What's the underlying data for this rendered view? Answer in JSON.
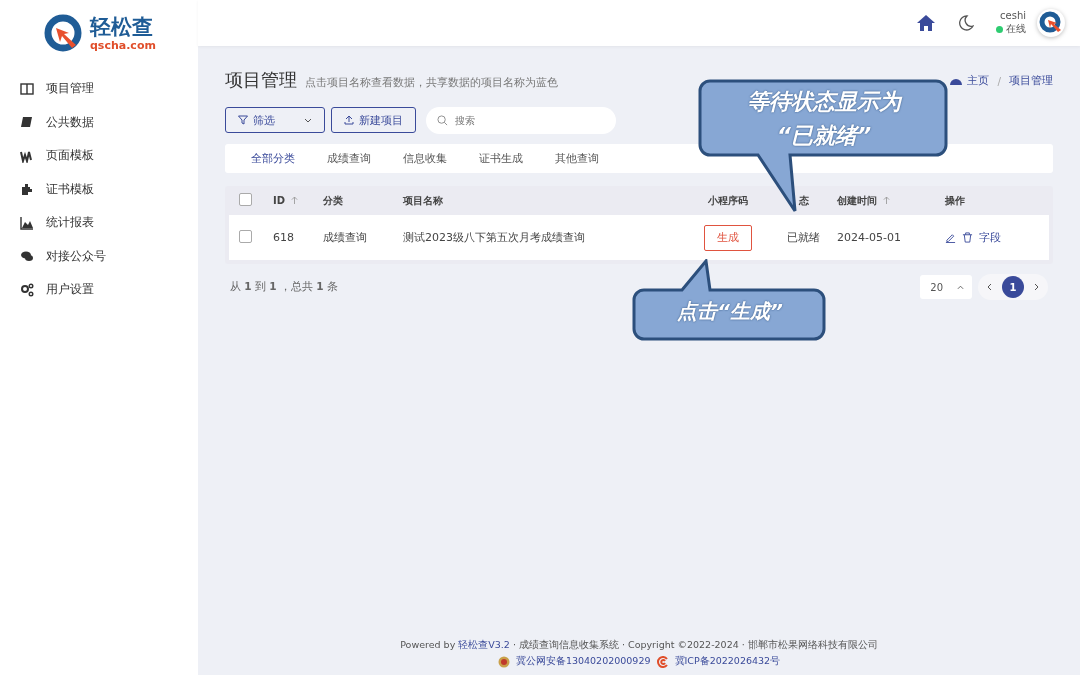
{
  "logo": {
    "name": "轻松查",
    "domain": "qscha.com"
  },
  "sidebar": {
    "items": [
      {
        "label": "项目管理"
      },
      {
        "label": "公共数据"
      },
      {
        "label": "页面模板"
      },
      {
        "label": "证书模板"
      },
      {
        "label": "统计报表"
      },
      {
        "label": "对接公众号"
      },
      {
        "label": "用户设置"
      }
    ]
  },
  "header": {
    "username": "ceshi",
    "status": "在线",
    "online": true
  },
  "page": {
    "title": "项目管理",
    "subtitle": "点击项目名称查看数据，共享数据的项目名称为蓝色",
    "breadcrumb": [
      "主页",
      "/",
      "项目管理"
    ]
  },
  "toolbar": {
    "filter": "筛选",
    "new_project": "新建项目",
    "search": {
      "placeholder": "搜索"
    }
  },
  "category_tabs": [
    {
      "label": "全部分类",
      "selected": true
    },
    {
      "label": "成绩查询",
      "selected": false
    },
    {
      "label": "信息收集",
      "selected": false
    },
    {
      "label": "证书生成",
      "selected": false
    },
    {
      "label": "其他查询",
      "selected": false
    }
  ],
  "table": {
    "all_checked": false,
    "columns": [
      {
        "label": "ID",
        "sortable": true
      },
      {
        "label": "分类",
        "sortable": false
      },
      {
        "label": "项目名称",
        "sortable": false
      },
      {
        "label": "小程序码",
        "sortable": false
      },
      {
        "label": "态",
        "sortable": false
      },
      {
        "label": "创建时间",
        "sortable": true
      },
      {
        "label": "操作",
        "sortable": false
      }
    ],
    "rows": [
      {
        "checked": false,
        "id": "618",
        "category": "成绩查询",
        "name": "测试2023级八下第五次月考成绩查询",
        "code_button": "生成",
        "status": "已就绪",
        "created": "2024-05-01",
        "field_link": "字段"
      }
    ]
  },
  "pagination": {
    "summary": "从 **1** 到 **1** ，总共 **1** 条",
    "page_size": "20",
    "pages": [
      {
        "label": "1",
        "selected": true
      }
    ]
  },
  "callouts": [
    {
      "lines": [
        "等待状态显示为",
        "“已就绪”"
      ]
    },
    {
      "lines": [
        "点击“生成”"
      ]
    }
  ],
  "footer": {
    "prefix": "Powered by ",
    "version_link": "轻松查V3.2",
    "suffix": " · 成绩查询信息收集系统 · Copyright ©2022-2024 · 邯郸市松果网络科技有限公司",
    "police_record": "冀公网安备13040202000929",
    "icp_record": "冀ICP备2022026432号"
  }
}
